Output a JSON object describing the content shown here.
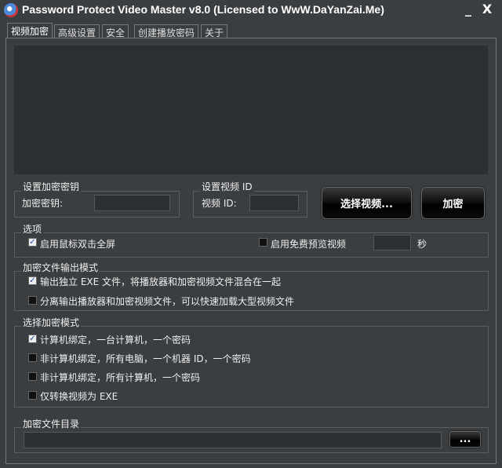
{
  "window": {
    "title": "Password Protect Video Master v8.0 (Licensed to WwW.DaYanZai.Me)",
    "minimize": "_",
    "close": "X"
  },
  "tabs": [
    "视频加密",
    "高级设置",
    "安全",
    "创建播放密码",
    "关于"
  ],
  "key_group": {
    "title": "设置加密密钥",
    "label": "加密密钥:",
    "value": ""
  },
  "id_group": {
    "title": "设置视频 ID",
    "label": "视频 ID:",
    "value": ""
  },
  "buttons": {
    "select_video": "选择视频...",
    "encrypt": "加密",
    "browse": "..."
  },
  "options": {
    "title": "选项",
    "fullscreen": {
      "label": "启用鼠标双击全屏",
      "checked": true
    },
    "preview": {
      "label": "启用免费预览视频",
      "checked": false
    },
    "preview_seconds": "",
    "seconds_unit": "秒"
  },
  "output_mode": {
    "title": "加密文件输出模式",
    "items": [
      {
        "label": "输出独立 EXE 文件，将播放器和加密视频文件混合在一起",
        "checked": true
      },
      {
        "label": "分离输出播放器和加密视频文件，可以快速加载大型视频文件",
        "checked": false
      }
    ]
  },
  "encrypt_mode": {
    "title": "选择加密模式",
    "items": [
      {
        "label": "计算机绑定，一台计算机，一个密码",
        "checked": true
      },
      {
        "label": "非计算机绑定，所有电脑，一个机器 ID，一个密码",
        "checked": false
      },
      {
        "label": "非计算机绑定，所有计算机，一个密码",
        "checked": false
      },
      {
        "label": "仅转换视频为 EXE",
        "checked": false
      }
    ]
  },
  "output_dir": {
    "title": "加密文件目录",
    "value": ""
  }
}
